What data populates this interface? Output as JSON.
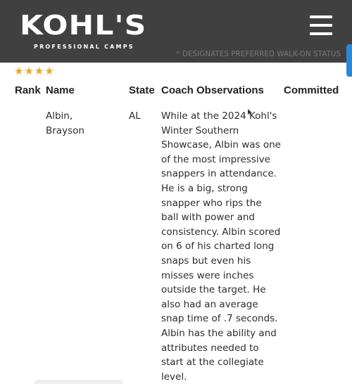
{
  "header": {
    "logo_main": "KOHL'S",
    "logo_sub": "PROFESSIONAL CAMPS",
    "note": "* DESIGNATES PREFERRED WALK-ON STATUS"
  },
  "rating": {
    "stars": "★★★★",
    "count": 4
  },
  "table": {
    "columns": [
      "Rank",
      "Name",
      "State",
      "Coach Observations",
      "Committed"
    ],
    "rows": [
      {
        "rank": "",
        "name_lines": [
          "Albin,",
          "Brayson"
        ],
        "state": "AL",
        "observation_lines": [
          "While at the 2024 Kohl's",
          "Winter Southern",
          "Showcase, Albin was one",
          "of the most impressive",
          "snappers in attendance.",
          "He is a big, strong",
          "snapper who rips the",
          "ball with power and",
          "consistency. Albin scored",
          "on 6 of his charted long",
          "snaps but even his",
          "misses were inches",
          "outside the target. He",
          "also had an average",
          "snap time of .7 seconds.",
          "Albin has the ability and",
          "attributes needed to",
          "start at the collegiate",
          "level."
        ],
        "committed": ""
      }
    ]
  },
  "colors": {
    "header_bg": "#404040",
    "star": "#e3ac22",
    "scroll_accent": "#2a87d8"
  },
  "icons": {
    "menu": "hamburger-menu-icon",
    "rating": "star-icon"
  }
}
